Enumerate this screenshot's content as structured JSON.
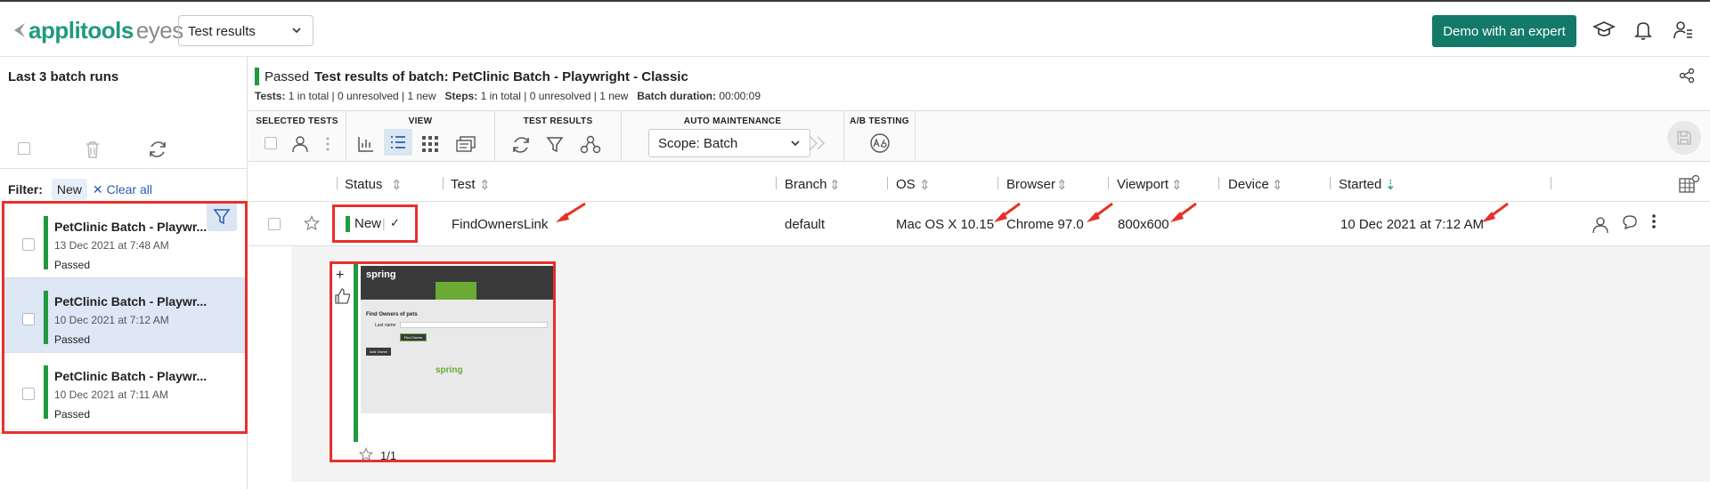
{
  "topbar": {
    "logo_primary": "applitools",
    "logo_secondary": "eyes",
    "page_select": "Test results",
    "demo_button": "Demo with an expert",
    "icons": [
      "tutorial-hat-icon",
      "bell-icon",
      "user-settings-icon"
    ]
  },
  "left_panel": {
    "title": "Last 3 batch runs",
    "filter_label": "Filter:",
    "filter_chip": "New",
    "clear_all": "Clear all",
    "batches": [
      {
        "name": "PetClinic Batch - Playwr...",
        "date": "13 Dec 2021 at 7:48 AM",
        "status": "Passed",
        "selected": false
      },
      {
        "name": "PetClinic Batch - Playwr...",
        "date": "10 Dec 2021 at 7:12 AM",
        "status": "Passed",
        "selected": true
      },
      {
        "name": "PetClinic Batch - Playwr...",
        "date": "10 Dec 2021 at 7:11 AM",
        "status": "Passed",
        "selected": false
      }
    ]
  },
  "header": {
    "status": "Passed",
    "title": "Test results of batch: PetClinic Batch - Playwright - Classic",
    "tests_label": "Tests:",
    "tests_total": "1 in total",
    "tests_unresolved": "0 unresolved",
    "tests_new": "1 new",
    "steps_label": "Steps:",
    "steps_total": "1 in total",
    "steps_unresolved": "0 unresolved",
    "steps_new": "1 new",
    "duration_label": "Batch duration:",
    "duration": "00:00:09"
  },
  "toolbar": {
    "selected_tests": "SELECTED TESTS",
    "view": "VIEW",
    "test_results": "TEST RESULTS",
    "auto_maintenance": "AUTO MAINTENANCE",
    "ab_testing": "A/B TESTING",
    "scope": "Scope: Batch"
  },
  "columns": [
    "Status",
    "Test",
    "Branch",
    "OS",
    "Browser",
    "Viewport",
    "Device",
    "Started"
  ],
  "row": {
    "status": "New",
    "test": "FindOwnersLink",
    "branch": "default",
    "os": "Mac OS X 10.15",
    "browser": "Chrome 97.0",
    "viewport": "800x600",
    "device": "",
    "started": "10 Dec 2021 at 7:12 AM"
  },
  "step": {
    "counter": "1/1",
    "shot_heading": "Find Owners of pets",
    "shot_field": "Last name",
    "shot_find_btn": "Find Owner",
    "shot_add_btn": "Add Owner",
    "shot_logo": "spring"
  },
  "colors": {
    "brand": "#1f9a7e",
    "demo": "#137a69",
    "passed": "#1f9a3e",
    "annotation": "#e8302a"
  }
}
